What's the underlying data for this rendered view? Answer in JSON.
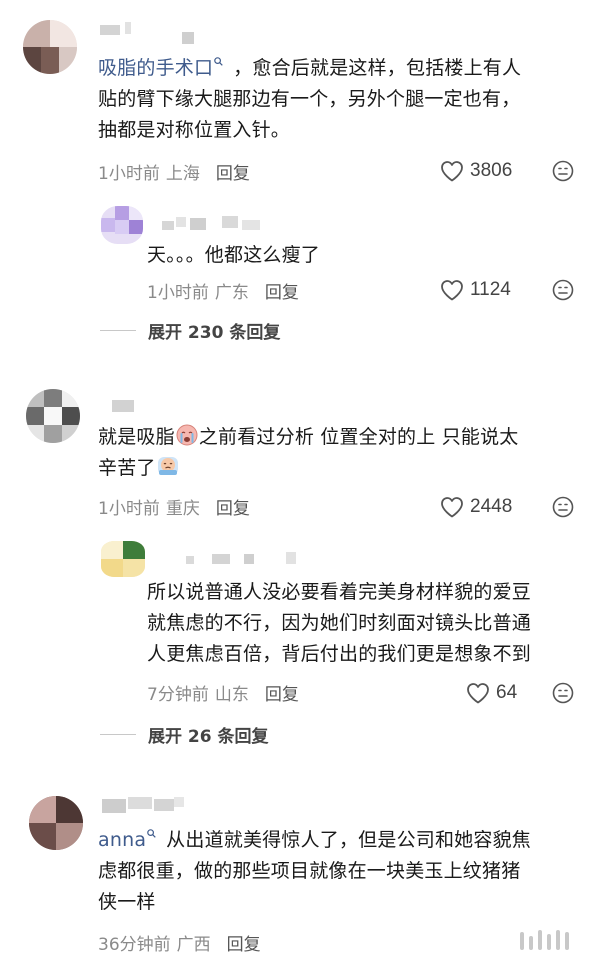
{
  "comments": [
    {
      "username_link": "吸脂的手术口",
      "lines": [
        "，愈合后就是这样，包括楼上有人",
        "贴的臂下缘大腿那边有一个，另外个腿一定也有，",
        "抽都是对称位置入针。"
      ],
      "time": "1小时前",
      "location": "上海",
      "reply": "回复",
      "likes": "3806"
    },
    {
      "lines": [
        "天。。。他都这么瘦了"
      ],
      "time": "1小时前",
      "location": "广东",
      "reply": "回复",
      "likes": "1124",
      "is_reply": true
    },
    {
      "lines": [
        "就是吸脂",
        "之前看过分析 位置全对的上 只能说太",
        "辛苦了"
      ],
      "time": "1小时前",
      "location": "重庆",
      "reply": "回复",
      "likes": "2448"
    },
    {
      "lines": [
        "所以说普通人没必要看着完美身材样貌的爱豆",
        "就焦虑的不行，因为她们时刻面对镜头比普通",
        "人更焦虑百倍，背后付出的我们更是想象不到"
      ],
      "time": "7分钟前",
      "location": "山东",
      "reply": "回复",
      "likes": "64",
      "is_reply": true
    },
    {
      "username_link": "anna",
      "lines": [
        "从出道就美得惊人了，但是公司和她容貌焦",
        "虑都很重，做的那些项目就像在一块美玉上纹猪猪",
        "侠一样"
      ],
      "time": "36分钟前",
      "location": "广西",
      "reply": "回复"
    }
  ],
  "expand_1": "展开 230 条回复",
  "expand_2": "展开 26 条回复",
  "icons": {
    "like": "heart-outline-icon",
    "dislike": "meh-face-icon",
    "search": "search-icon"
  }
}
